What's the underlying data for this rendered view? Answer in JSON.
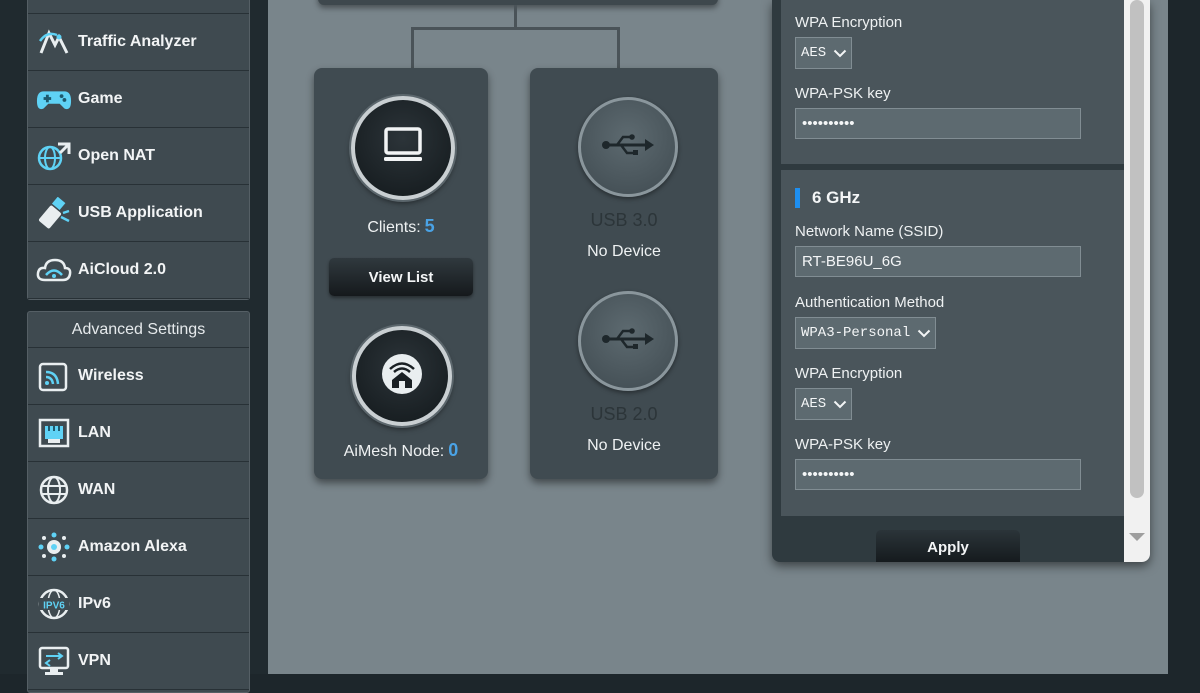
{
  "sidebar": {
    "general_items": [
      {
        "label": "Traffic Analyzer",
        "icon": "traffic-analyzer-icon"
      },
      {
        "label": "Game",
        "icon": "gamepad-icon"
      },
      {
        "label": "Open NAT",
        "icon": "open-nat-icon"
      },
      {
        "label": "USB Application",
        "icon": "usb-application-icon"
      },
      {
        "label": "AiCloud 2.0",
        "icon": "aicloud-icon"
      }
    ],
    "advanced_header": "Advanced Settings",
    "advanced_items": [
      {
        "label": "Wireless",
        "icon": "wireless-icon"
      },
      {
        "label": "LAN",
        "icon": "lan-icon"
      },
      {
        "label": "WAN",
        "icon": "wan-globe-icon"
      },
      {
        "label": "Amazon Alexa",
        "icon": "alexa-icon"
      },
      {
        "label": "IPv6",
        "icon": "ipv6-icon"
      },
      {
        "label": "VPN",
        "icon": "vpn-icon"
      }
    ]
  },
  "network_map": {
    "clients_label": "Clients:",
    "clients_count": "5",
    "view_list_label": "View List",
    "aimesh_label": "AiMesh Node:",
    "aimesh_count": "0",
    "usb_ports": [
      {
        "name": "USB 3.0",
        "status": "No Device"
      },
      {
        "name": "USB 2.0",
        "status": "No Device"
      }
    ]
  },
  "wireless_panel": {
    "upper_band": {
      "encryption_label": "WPA Encryption",
      "encryption_value": "AES",
      "psk_label": "WPA-PSK key",
      "psk_value": "••••••••••"
    },
    "band_6ghz": {
      "title": "6 GHz",
      "ssid_label": "Network Name (SSID)",
      "ssid_value": "RT-BE96U_6G",
      "auth_label": "Authentication Method",
      "auth_value": "WPA3-Personal",
      "encryption_label": "WPA Encryption",
      "encryption_value": "AES",
      "psk_label": "WPA-PSK key",
      "psk_value": "••••••••••"
    },
    "apply_label": "Apply"
  },
  "colors": {
    "accent_blue": "#1e8ff0",
    "count_blue": "#4aa3e6",
    "icon_cyan": "#5fd2f5"
  }
}
